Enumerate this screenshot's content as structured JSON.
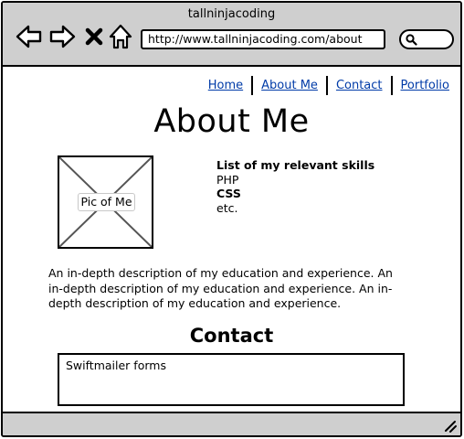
{
  "window": {
    "title": "tallninjacoding"
  },
  "toolbar": {
    "back_icon": "arrow-left-icon",
    "forward_icon": "arrow-right-icon",
    "stop_icon": "close-icon",
    "home_icon": "home-icon",
    "url": "http://www.tallninjacoding.com/about",
    "search_icon": "search-icon"
  },
  "nav": {
    "links": [
      "Home",
      "About Me",
      "Contact",
      "Portfolio"
    ],
    "link_color": "#003ba8"
  },
  "page": {
    "title": "About Me",
    "image_label": "Pic of Me",
    "skills": {
      "heading": "List of my relevant skills",
      "items": [
        "PHP",
        "CSS",
        "etc."
      ]
    },
    "description": "An in-depth description of my education and experience.  An in-depth description of my education and experience.  An in-depth description of my education and experience.",
    "contact_title": "Contact",
    "form_placeholder": "Swiftmailer forms"
  },
  "colors": {
    "chrome": "#cfcfcf",
    "border": "#000000",
    "background": "#ffffff"
  }
}
